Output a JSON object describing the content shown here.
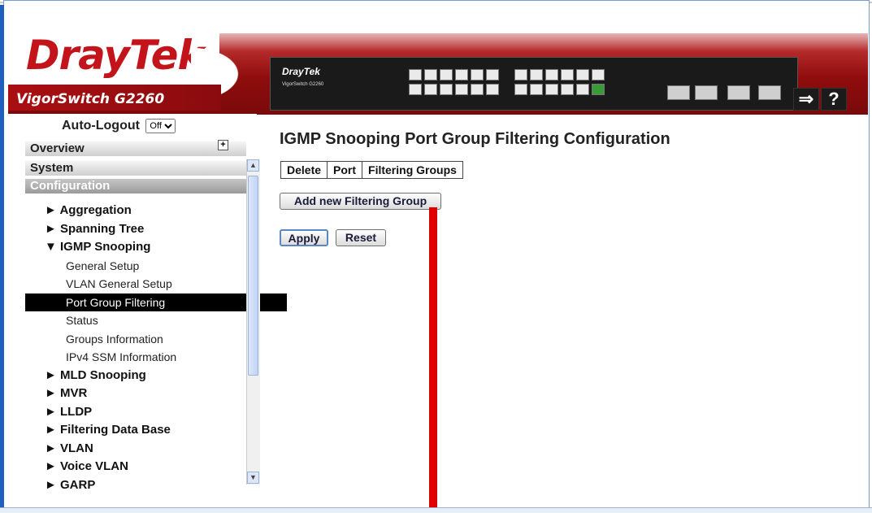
{
  "header": {
    "brand": "DrayTek",
    "model": "VigorSwitch G2260",
    "panel_brand": "DrayTek",
    "panel_model": "VigorSwitch G2260"
  },
  "sidebar": {
    "auto_logout_label": "Auto-Logout",
    "auto_logout_value": "Off",
    "overview": "Overview",
    "system": "System",
    "configuration": "Configuration",
    "items": [
      {
        "label": "► Aggregation",
        "level": 1
      },
      {
        "label": "► Spanning Tree",
        "level": 1
      },
      {
        "label": "▼ IGMP Snooping",
        "level": 1
      },
      {
        "label": "General Setup",
        "level": 2
      },
      {
        "label": "VLAN General Setup",
        "level": 2
      },
      {
        "label": "Port Group Filtering",
        "level": 2,
        "active": true
      },
      {
        "label": "Status",
        "level": 2
      },
      {
        "label": "Groups Information",
        "level": 2
      },
      {
        "label": "IPv4 SSM Information",
        "level": 2
      },
      {
        "label": "► MLD Snooping",
        "level": 1
      },
      {
        "label": "► MVR",
        "level": 1
      },
      {
        "label": "► LLDP",
        "level": 1
      },
      {
        "label": "► Filtering Data Base",
        "level": 1
      },
      {
        "label": "► VLAN",
        "level": 1
      },
      {
        "label": "► Voice VLAN",
        "level": 1
      },
      {
        "label": "► GARP",
        "level": 1
      }
    ]
  },
  "main": {
    "title": "IGMP Snooping Port Group Filtering Configuration",
    "columns": [
      "Delete",
      "Port",
      "Filtering Groups"
    ],
    "add_button": "Add new Filtering Group",
    "apply_button": "Apply",
    "reset_button": "Reset"
  },
  "colors": {
    "brand_red": "#c3141b",
    "header_band": "#8e0d0d",
    "active_nav_bg": "#000000",
    "callout": "#e00000"
  }
}
